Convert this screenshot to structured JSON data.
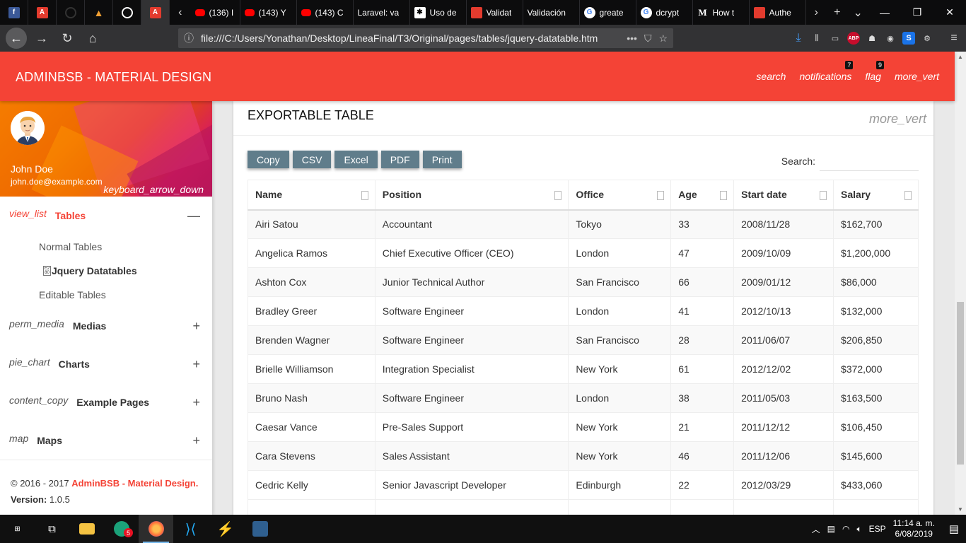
{
  "browser": {
    "tabs": [
      {
        "icon": "facebook-icon",
        "title": ""
      },
      {
        "icon": "angular-icon",
        "title": ""
      },
      {
        "icon": "github-icon",
        "title": ""
      },
      {
        "icon": "vuetify-icon",
        "title": ""
      },
      {
        "icon": "globe-icon",
        "title": ""
      },
      {
        "icon": "angular-icon",
        "title": ""
      },
      {
        "icon": "youtube-icon",
        "title": "(136) I"
      },
      {
        "icon": "youtube-icon",
        "title": "(143) Y"
      },
      {
        "icon": "youtube-icon",
        "title": "(143) C"
      },
      {
        "icon": "",
        "title": "Laravel: va"
      },
      {
        "icon": "star-icon",
        "title": "Uso de"
      },
      {
        "icon": "page-icon",
        "title": "Validat"
      },
      {
        "icon": "",
        "title": "Validación"
      },
      {
        "icon": "google-icon",
        "title": "greate"
      },
      {
        "icon": "google-icon",
        "title": "dcrypt"
      },
      {
        "icon": "medium-icon",
        "title": "How t"
      },
      {
        "icon": "page-icon",
        "title": "Authe"
      }
    ],
    "url": "file:///C:/Users/Yonathan/Desktop/LineaFinal/T3/Original/pages/tables/jquery-datatable.htm"
  },
  "app": {
    "brand": "ADMINBSB - MATERIAL DESIGN",
    "actions": {
      "search": "search",
      "notifications": "notifications",
      "notifications_count": "7",
      "flag": "flag",
      "flag_count": "9",
      "more": "more_vert"
    }
  },
  "user": {
    "name": "John Doe",
    "email": "john.doe@example.com",
    "toggle": "keyboard_arrow_down"
  },
  "menu": {
    "tables": {
      "icon": "view_list",
      "label": "Tables",
      "toggle": "—"
    },
    "sub": {
      "normal": "Normal Tables",
      "jquery": "Jquery Datatables",
      "editable": "Editable Tables"
    },
    "medias": {
      "icon": "perm_media",
      "label": "Medias",
      "toggle": "+"
    },
    "charts": {
      "icon": "pie_chart",
      "label": "Charts",
      "toggle": "+"
    },
    "examples": {
      "icon": "content_copy",
      "label": "Example Pages",
      "toggle": "+"
    },
    "maps": {
      "icon": "map",
      "label": "Maps",
      "toggle": "+"
    }
  },
  "footer": {
    "copyright": "© 2016 - 2017 ",
    "brand": "AdminBSB - Material Design",
    "dot": ".",
    "version_label": "Version: ",
    "version": "1.0.5"
  },
  "card": {
    "title": "EXPORTABLE TABLE",
    "menu": "more_vert",
    "buttons": {
      "copy": "Copy",
      "csv": "CSV",
      "excel": "Excel",
      "pdf": "PDF",
      "print": "Print"
    },
    "search_label": "Search:"
  },
  "table": {
    "columns": [
      "Name",
      "Position",
      "Office",
      "Age",
      "Start date",
      "Salary"
    ],
    "rows": [
      [
        "Airi Satou",
        "Accountant",
        "Tokyo",
        "33",
        "2008/11/28",
        "$162,700"
      ],
      [
        "Angelica Ramos",
        "Chief Executive Officer (CEO)",
        "London",
        "47",
        "2009/10/09",
        "$1,200,000"
      ],
      [
        "Ashton Cox",
        "Junior Technical Author",
        "San Francisco",
        "66",
        "2009/01/12",
        "$86,000"
      ],
      [
        "Bradley Greer",
        "Software Engineer",
        "London",
        "41",
        "2012/10/13",
        "$132,000"
      ],
      [
        "Brenden Wagner",
        "Software Engineer",
        "San Francisco",
        "28",
        "2011/06/07",
        "$206,850"
      ],
      [
        "Brielle Williamson",
        "Integration Specialist",
        "New York",
        "61",
        "2012/12/02",
        "$372,000"
      ],
      [
        "Bruno Nash",
        "Software Engineer",
        "London",
        "38",
        "2011/05/03",
        "$163,500"
      ],
      [
        "Caesar Vance",
        "Pre-Sales Support",
        "New York",
        "21",
        "2011/12/12",
        "$106,450"
      ],
      [
        "Cara Stevens",
        "Sales Assistant",
        "New York",
        "46",
        "2011/12/06",
        "$145,600"
      ],
      [
        "Cedric Kelly",
        "Senior Javascript Developer",
        "Edinburgh",
        "22",
        "2012/03/29",
        "$433,060"
      ]
    ]
  },
  "taskbar": {
    "language": "ESP",
    "time": "11:14 a. m.",
    "date": "6/08/2019",
    "chrome_badge": "5"
  }
}
